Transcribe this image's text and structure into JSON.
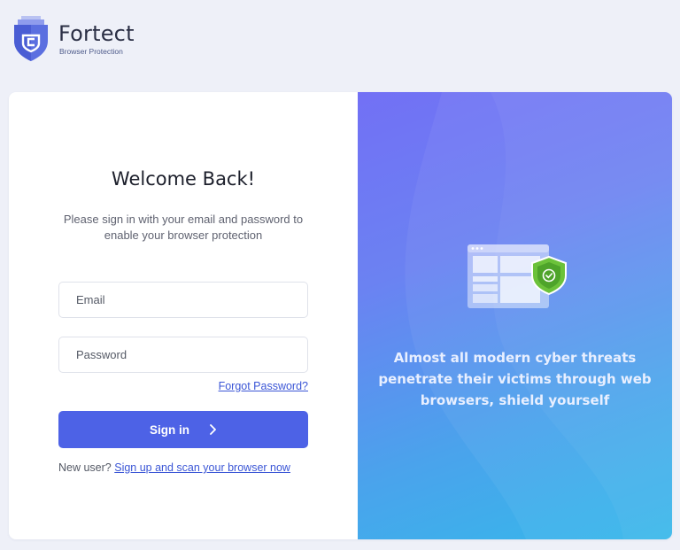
{
  "brand": {
    "name": "Fortect",
    "subtitle": "Browser Protection",
    "logo_icon": "shield-logo-icon",
    "colors": {
      "shield": "#5b6fe0",
      "shield_dark": "#3c4fc7",
      "text": "#2b2f45"
    }
  },
  "login": {
    "title": "Welcome Back!",
    "subtitle": "Please sign in with your email and password to enable your browser protection",
    "email": {
      "placeholder": "Email",
      "value": ""
    },
    "password": {
      "placeholder": "Password",
      "value": ""
    },
    "forgot_link": "Forgot Password?",
    "signin_button": "Sign in",
    "signin_icon": "chevron-right-icon",
    "new_user_text": "New user?",
    "signup_link": "Sign up and scan your browser now",
    "colors": {
      "primary": "#4d62e6",
      "link": "#3b56d6"
    }
  },
  "promo": {
    "tagline": "Almost all modern cyber threats penetrate their victims through web browsers, shield yourself",
    "illustration_icons": [
      "browser-window-icon",
      "green-shield-check-icon"
    ],
    "colors": {
      "gradient_start": "#7270f5",
      "gradient_end": "#35b8ea",
      "shield_green": "#6cc23a"
    }
  }
}
